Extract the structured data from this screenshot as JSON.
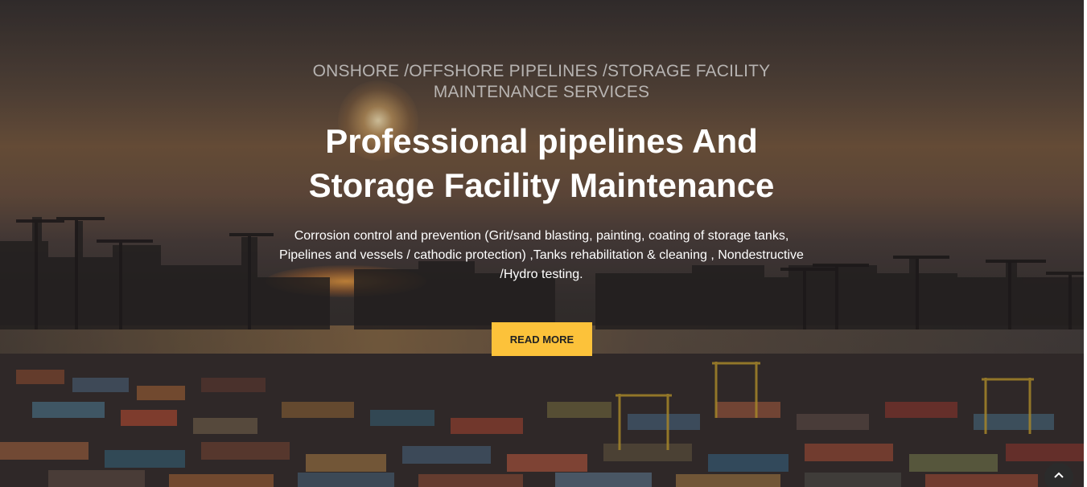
{
  "hero": {
    "subtitle_line1": "ONSHORE /OFFSHORE PIPELINES /STORAGE FACILITY",
    "subtitle_line2": "MAINTENANCE SERVICES",
    "title_line1": "Professional pipelines And",
    "title_line2": "Storage Facility Maintenance",
    "description_line1": "Corrosion control and prevention (Grit/sand blasting, painting, coating of storage tanks,",
    "description_line2": "Pipelines and vessels / cathodic protection) ,Tanks rehabilitation & cleaning , Nondestructive",
    "description_line3": "/Hydro testing.",
    "button_label": "READ MORE"
  },
  "scroll_top": {
    "icon": "chevron-up-icon"
  },
  "colors": {
    "accent": "#fcc23a",
    "title": "#ffffff",
    "subtitle": "#dcdcdc",
    "scroll_button": "#2b2b2b"
  }
}
